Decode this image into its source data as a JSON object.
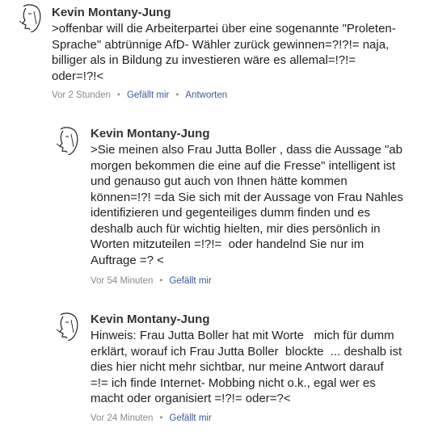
{
  "comments": [
    {
      "author": "Kevin Montany-Jung",
      "avatar_icon": "sketch-profile-face-icon",
      "lines": [
        ">offenbar will die Arbeiterpartei über eine sogenannte \"Proleten-",
        "Sprache\" abtrünnige AfD- Wähler zurück gewinnen=?!?!= naja,",
        "billiger als in Bildung zu investieren wäre es allemal=!?!=",
        "oder=!?!<"
      ],
      "time": "Vor 2 Stunden",
      "like_label": "Gefällt mir",
      "reply_label": "Antworten"
    },
    {
      "author": "Kevin Montany-Jung",
      "avatar_icon": "sketch-profile-face-icon",
      "lines": [
        ">Sie meinen also Frau Jutta Boller , dass die Aussage \"ab",
        "morgen bekommen die eine auf die Fresse\" intelligent ist",
        "und genauso gut auch von Ihnen hätte kommen",
        "können=!?! =da Sie sich mit der Aussage von Frau Nahles",
        "identifizieren und gegenteiliges dumm finden und es",
        "deshalb auch für wichtig hielten, mir dies persönlich in",
        "Worten mitzuteilen =!?!=  oder handelnd Sie nur im",
        "Auftrage =? <"
      ],
      "time": "Vor 54 Minuten",
      "like_label": "Gefällt mir"
    },
    {
      "author": "Kevin Montany-Jung",
      "avatar_icon": "sketch-profile-face-icon",
      "lines": [
        "Hinweis: Frau Jutta Boller hat mit Worte   mich für dumm",
        "erklärt, worauf ich Frau Jutta Boller  blockte  ... deshalb ist",
        "dies hier nicht mehr sichtbar, nur meine Antwort darauf",
        "=!= ich finde Internet- Mobbing nicht o.k., egal wer es",
        "macht oder organisiert =!?!= oder=?<"
      ],
      "time": "Vor 24 Minuten",
      "like_label": "Gefällt mir"
    }
  ],
  "colors": {
    "author": "#333333",
    "text": "#222222",
    "meta": "#8a8a8a",
    "link": "#3b5998"
  }
}
